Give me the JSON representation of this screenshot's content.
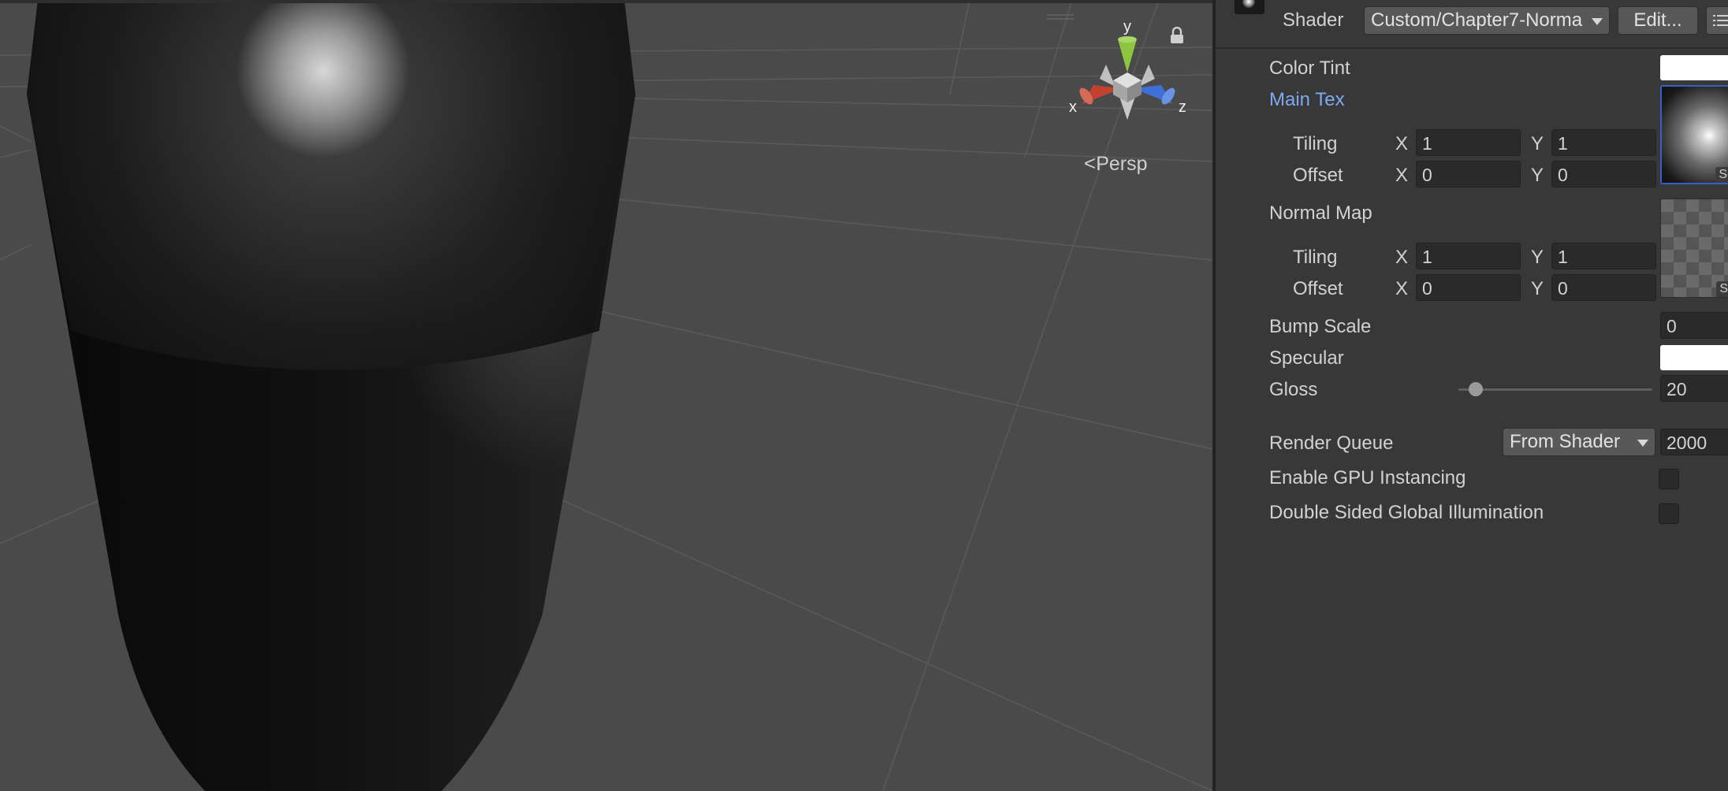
{
  "scene": {
    "persp_label": "Persp",
    "gizmo": {
      "x_label": "x",
      "y_label": "y",
      "z_label": "z"
    },
    "colors": {
      "axis_x": "#c2422f",
      "axis_y": "#8ec63f",
      "axis_z": "#3f70d8",
      "background": "#4a4a4a"
    }
  },
  "inspector": {
    "shader_label": "Shader",
    "shader_value": "Custom/Chapter7-Norma",
    "edit_button": "Edit...",
    "color_tint_label": "Color Tint",
    "main_tex": {
      "label": "Main Tex",
      "tiling_label": "Tiling",
      "offset_label": "Offset",
      "tiling_x": "1",
      "tiling_y": "1",
      "offset_x": "0",
      "offset_y": "0",
      "select_label": "Se"
    },
    "normal_map": {
      "label": "Normal Map",
      "tiling_label": "Tiling",
      "offset_label": "Offset",
      "tiling_x": "1",
      "tiling_y": "1",
      "offset_x": "0",
      "offset_y": "0",
      "select_label": "Se"
    },
    "axis_x": "X",
    "axis_y": "Y",
    "bump_scale": {
      "label": "Bump Scale",
      "value": "0"
    },
    "specular_label": "Specular",
    "gloss": {
      "label": "Gloss",
      "value": "20"
    },
    "render_queue": {
      "label": "Render Queue",
      "mode": "From Shader",
      "value": "2000"
    },
    "gpu_instancing_label": "Enable GPU Instancing",
    "double_sided_gi_label": "Double Sided Global Illumination",
    "colors": {
      "link": "#7ea9f2",
      "swatch": "#ffffff"
    }
  }
}
